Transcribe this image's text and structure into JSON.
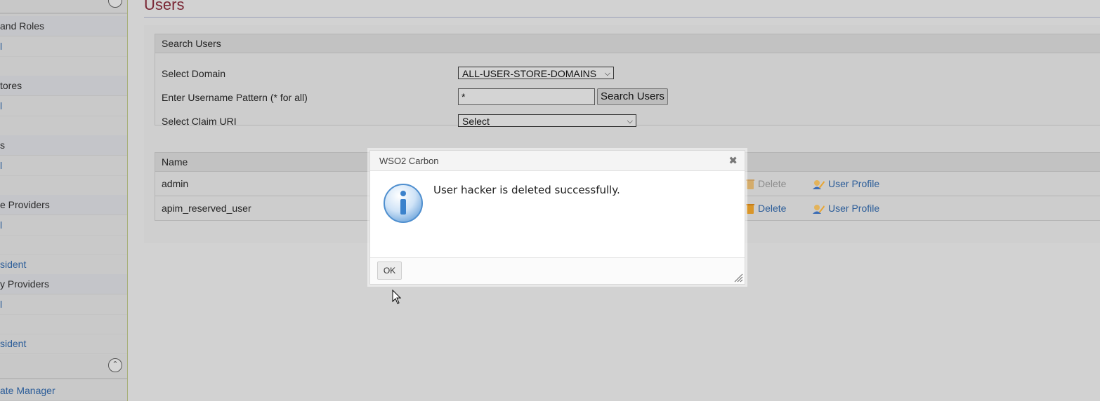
{
  "sidebar": {
    "items": [
      {
        "label": "and Roles",
        "kind": "head"
      },
      {
        "label": "l",
        "kind": "link"
      },
      {
        "label": "",
        "kind": "link"
      },
      {
        "label": "tores",
        "kind": "head"
      },
      {
        "label": "l",
        "kind": "link"
      },
      {
        "label": "",
        "kind": "link"
      },
      {
        "label": "s",
        "kind": "head"
      },
      {
        "label": "l",
        "kind": "link"
      },
      {
        "label": "",
        "kind": "link"
      },
      {
        "label": "e Providers",
        "kind": "head"
      },
      {
        "label": "l",
        "kind": "link"
      },
      {
        "label": "",
        "kind": "link"
      },
      {
        "label": "sident",
        "kind": "link"
      },
      {
        "label": "y Providers",
        "kind": "head"
      },
      {
        "label": "l",
        "kind": "link"
      },
      {
        "label": "",
        "kind": "link"
      },
      {
        "label": "sident",
        "kind": "link"
      },
      {
        "label": "ate Manager",
        "kind": "link"
      }
    ]
  },
  "page": {
    "title": "Users"
  },
  "search": {
    "header": "Search Users",
    "domain_label": "Select Domain",
    "domain_value": "ALL-USER-STORE-DOMAINS",
    "pattern_label": "Enter Username Pattern (* for all)",
    "pattern_value": "*",
    "search_button": "Search Users",
    "claim_label": "Select Claim URI",
    "claim_value": "Select"
  },
  "users_table": {
    "header_name": "Name",
    "rows": [
      {
        "name": "admin",
        "delete": "Delete",
        "profile": "User Profile",
        "delete_disabled": true
      },
      {
        "name": "apim_reserved_user",
        "delete": "Delete",
        "profile": "User Profile",
        "delete_disabled": false
      }
    ]
  },
  "dialog": {
    "title": "WSO2 Carbon",
    "message": "User hacker is deleted successfully.",
    "ok_label": "OK",
    "icon": "info-icon"
  },
  "colors": {
    "title": "#7a2735",
    "link": "#2c5d99",
    "disabled": "#8c8c8c"
  }
}
